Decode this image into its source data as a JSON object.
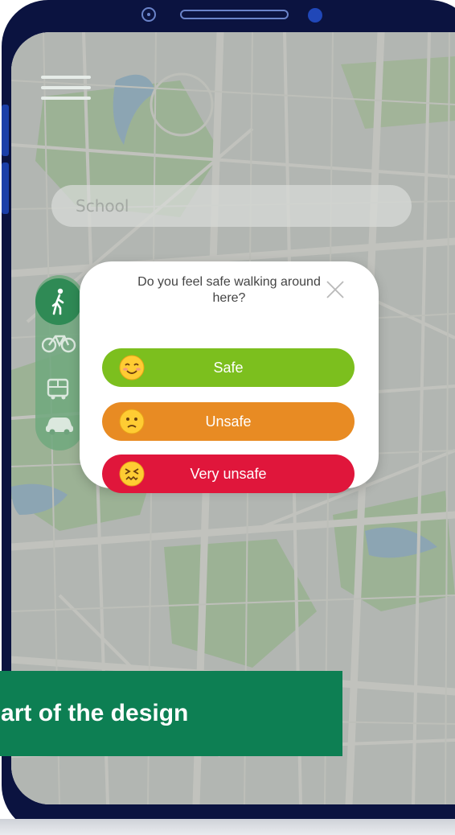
{
  "search": {
    "placeholder": "School"
  },
  "transport_modes": [
    {
      "name": "walk",
      "icon": "walking-person-icon",
      "selected": true
    },
    {
      "name": "bike",
      "icon": "bicycle-icon",
      "selected": false
    },
    {
      "name": "bus",
      "icon": "bus-icon",
      "selected": false
    },
    {
      "name": "car",
      "icon": "car-icon",
      "selected": false
    }
  ],
  "dialog": {
    "question": "Do you feel safe walking around here?",
    "options": [
      {
        "label": "Safe",
        "emoji": "smiling-face-icon",
        "color": "#7cbf1e"
      },
      {
        "label": "Unsafe",
        "emoji": "frowning-face-icon",
        "color": "#e88b23"
      },
      {
        "label": "Very unsafe",
        "emoji": "confounded-face-icon",
        "color": "#e0163b"
      }
    ]
  },
  "banner": {
    "text": "heart of the design",
    "color": "#0d7f53"
  },
  "colors": {
    "phone_frame": "#0b1340",
    "accent_green": "#2f8a55"
  }
}
